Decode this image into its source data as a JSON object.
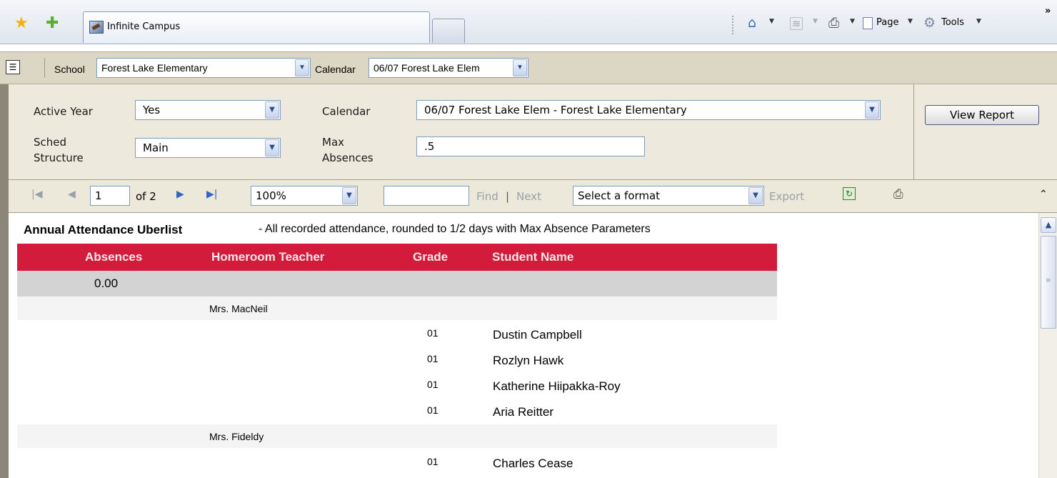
{
  "browser": {
    "tab_title": "Infinite Campus",
    "toolbar": {
      "page_label": "Page",
      "tools_label": "Tools",
      "more_label": "»"
    }
  },
  "app_bar": {
    "school_label": "School",
    "school_value": "Forest Lake Elementary",
    "calendar_label": "Calendar",
    "calendar_value": "06/07 Forest Lake Elem"
  },
  "params": {
    "active_year_label": "Active Year",
    "active_year_value": "Yes",
    "sched_structure_label_1": "Sched",
    "sched_structure_label_2": "Structure",
    "sched_structure_value": "Main",
    "calendar_label": "Calendar",
    "calendar_value": "06/07 Forest Lake Elem - Forest Lake Elementary",
    "max_absences_label_1": "Max",
    "max_absences_label_2": "Absences",
    "max_absences_value": ".5",
    "view_report_label": "View Report"
  },
  "viewer": {
    "page_value": "1",
    "page_of": "of 2",
    "zoom_value": "100%",
    "find_value": "",
    "find_label": "Find",
    "separator": "|",
    "next_label": "Next",
    "format_value": "Select a format",
    "export_label": "Export"
  },
  "report": {
    "title": "Annual Attendance Uberlist",
    "subtitle": "- All recorded attendance, rounded to 1/2 days with Max Absence Parameters",
    "columns": [
      "Absences",
      "Homeroom Teacher",
      "Grade",
      "Student Name"
    ],
    "total_absences": "0.00",
    "groups": [
      {
        "teacher": "Mrs. MacNeil",
        "students": [
          {
            "grade": "01",
            "name": "Dustin Campbell"
          },
          {
            "grade": "01",
            "name": "Rozlyn Hawk"
          },
          {
            "grade": "01",
            "name": "Katherine Hiipakka-Roy"
          },
          {
            "grade": "01",
            "name": "Aria Reitter"
          }
        ]
      },
      {
        "teacher": "Mrs. Fideldy",
        "students": [
          {
            "grade": "01",
            "name": "Charles Cease"
          }
        ]
      }
    ]
  },
  "colors": {
    "header_red": "#d31c3c",
    "panel_bg": "#edeadd",
    "app_bar_bg": "#dcd7c4"
  }
}
